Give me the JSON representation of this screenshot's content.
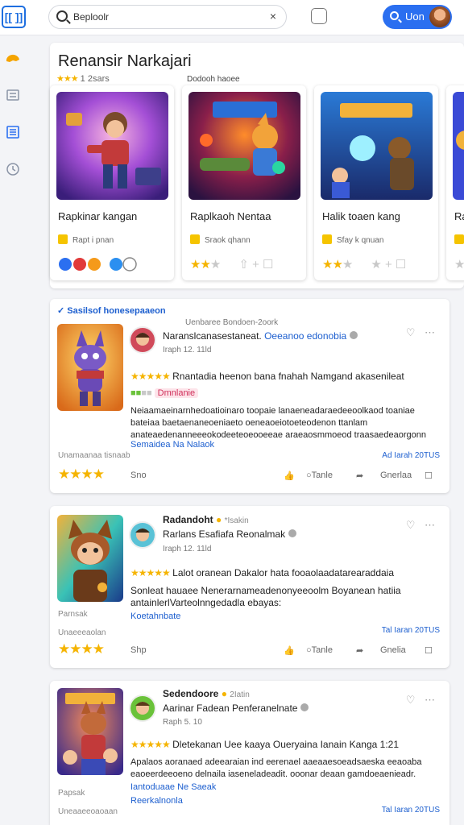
{
  "header": {
    "logo_text": "[[ ]]",
    "search_value": "Beploolr",
    "clear_symbol": "×",
    "signin_label": "Uon"
  },
  "sidebar": {
    "icons": [
      "palette-icon",
      "layers-icon",
      "library-icon",
      "history-icon"
    ]
  },
  "featured": {
    "title": "Renansir Narkajari",
    "rating_stars": "★★★",
    "rating_text": "1 2sars",
    "label": "Dodooh haoee",
    "apps": [
      {
        "name": "Rapkinar kangan",
        "sub": "Rapt i pnan",
        "stars": "",
        "grey_stars": ""
      },
      {
        "name": "Raplkaoh Nentaa",
        "sub": "Sraok qhann",
        "stars": "★★",
        "grey_stars": "★"
      },
      {
        "name": "Halik toaen kang",
        "sub": "Sfay k qnuan",
        "stars": "★★",
        "grey_stars": "★"
      },
      {
        "name": "Ra",
        "sub": "",
        "stars": "",
        "grey_stars": "★"
      }
    ]
  },
  "reviews": [
    {
      "section_title": "Sasilsof honesepaaeon",
      "section_sub": "Uenbaree Bondoen-2oork",
      "name": "Naranslcanasestaneat.",
      "name_link": "Oeeanoo edonobia",
      "date": "Iraph 12. 11ld",
      "headline_stars": "★★★★★",
      "headline": "Rnantadia heenon bana fnahah Namgand akasenileat",
      "tag": "Dmnlanie",
      "body": "Neiaamaeinarnhedoatioinaro toopaie lanaeneadaraedeeoolkaod toaniae bateiaa baetaenaneoeniaeto oeneaoeiotoeteodenon ttanlam anateaedenanneeeokodeeteoeooeeae araeaosmmoeod traasaedeaorgonn oenlenn...",
      "link": "Semaidea Na Nalaok",
      "meta": "Unamaanaa tisnaab",
      "post_date": "Ad Iarah 20TUS",
      "foot_stars": "★★★★",
      "foot": [
        "Sno",
        "Tanle",
        "Gnerlaa"
      ]
    },
    {
      "section_title": "",
      "section_sub": "",
      "name": "Radandoht",
      "name_extra": "*Isakin",
      "name_sub": "Rarlans Esafiafa Reonalmak",
      "date": "Iraph 12. 11ld",
      "headline_stars": "★★★★★",
      "headline": "Lalot oranean Dakalor hata fooaolaadatarearaddaia",
      "body": "Sonleat hauaee Nenerarnameadenonyeeoolm Boyanean hatiia antainlerlVarteolnngedadla ebayas:",
      "link": "Koetahnbate",
      "meta": "Parnsak",
      "meta2": "Unaeeeaolan",
      "post_date": "Tal Iaran 20TUS",
      "foot_stars": "★★★★",
      "foot": [
        "Shp",
        "Tanle",
        "Gnelia"
      ]
    },
    {
      "name": "Sedendoore",
      "name_extra": "2Iatin",
      "name_sub": "Aarinar Fadean Penferanelnate",
      "date": "Raph 5. 10",
      "headline_stars": "★★★★★",
      "headline": "Dletekanan Uee kaaya Oueryaina Ianain Kanga 1:21",
      "body": "Apalaos aoranaed adeearaian ind eerenael aaeaaesoeadsaeska eeaoaba eaoeerdeeoeno delnaila iaseneladeadit. ooonar deaan gamdoeaenieadr.",
      "link": "Iantoduaae Ne Saeak",
      "link2": "Reerkalnonla",
      "meta": "Papsak",
      "meta2": "Uneaaeeoaoaan",
      "post_date": "Tal Iaran 20TUS"
    }
  ],
  "colors": {
    "accent": "#2b6ff0",
    "star": "#f5b400",
    "link": "#1d5fcf"
  }
}
